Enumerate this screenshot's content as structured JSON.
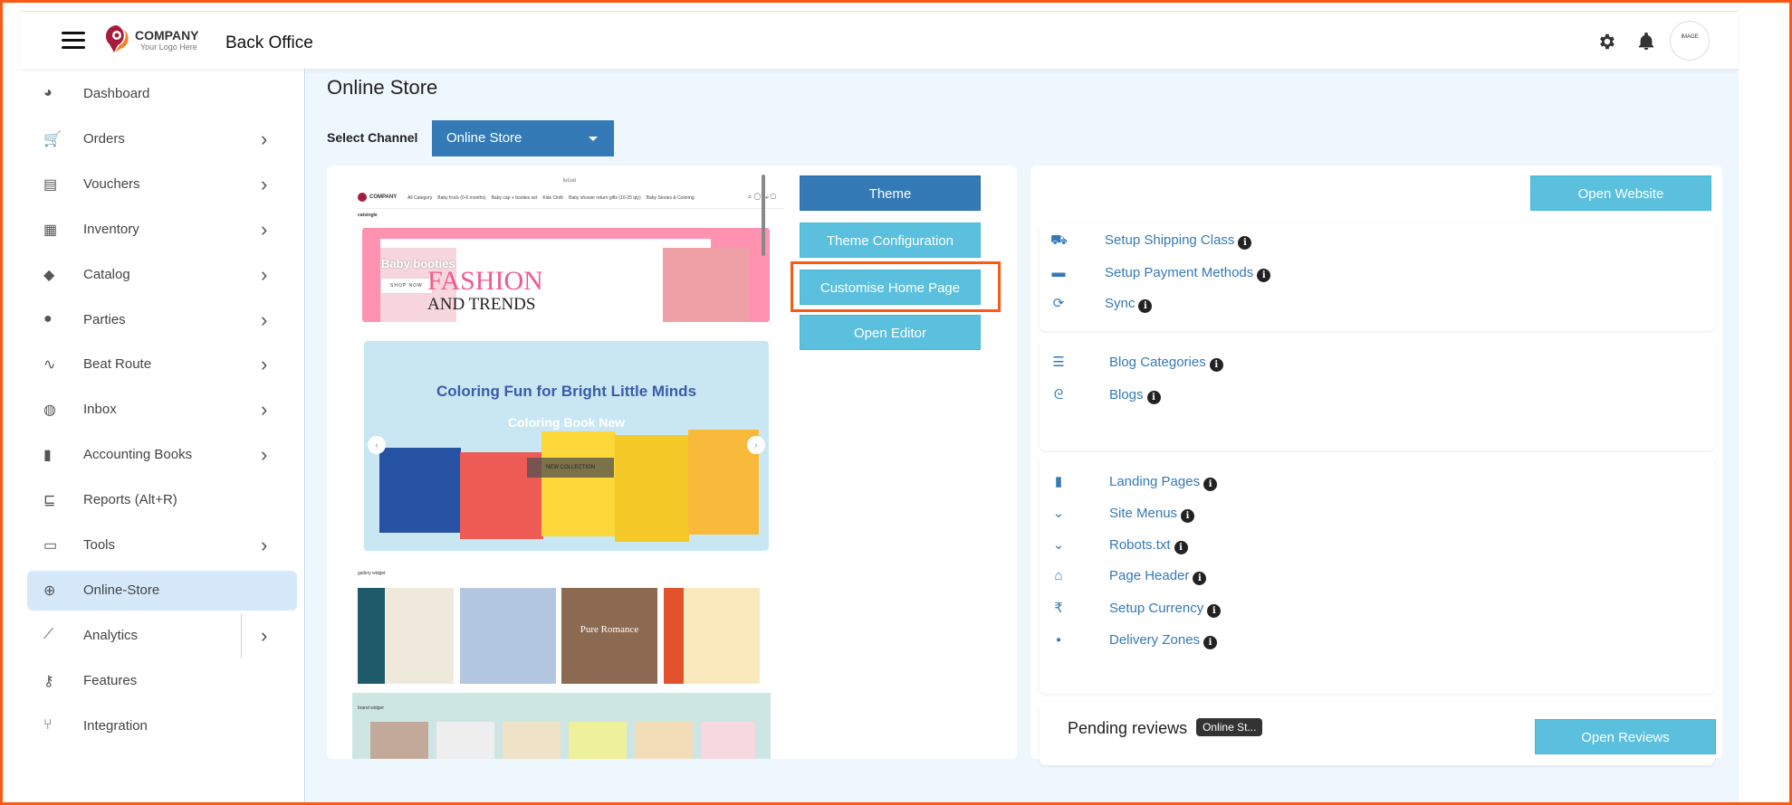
{
  "header": {
    "brand_name": "COMPANY",
    "brand_tagline": "Your Logo Here",
    "app_title": "Back Office",
    "avatar_text": "IMAGE",
    "icons": [
      "menu-icon",
      "gear-icon",
      "bell-icon"
    ]
  },
  "colors": {
    "primary": "#337ab7",
    "info": "#5bc0de",
    "highlight": "#fb5a14",
    "active_bg": "#d6e9fb"
  },
  "sidebar": {
    "items": [
      {
        "label": "Dashboard",
        "icon": "dashboard-icon",
        "chevron": false
      },
      {
        "label": "Orders",
        "icon": "cart-icon",
        "chevron": true
      },
      {
        "label": "Vouchers",
        "icon": "file-invoice-icon",
        "chevron": true
      },
      {
        "label": "Inventory",
        "icon": "boxes-icon",
        "chevron": true
      },
      {
        "label": "Catalog",
        "icon": "tags-icon",
        "chevron": true
      },
      {
        "label": "Parties",
        "icon": "user-icon",
        "chevron": true
      },
      {
        "label": "Beat Route",
        "icon": "route-icon",
        "chevron": true
      },
      {
        "label": "Inbox",
        "icon": "comments-icon",
        "chevron": true
      },
      {
        "label": "Accounting Books",
        "icon": "book-icon",
        "chevron": true
      },
      {
        "label": "Reports (Alt+R)",
        "icon": "chart-icon",
        "chevron": false
      },
      {
        "label": "Tools",
        "icon": "toolbox-icon",
        "chevron": true
      },
      {
        "label": "Online-Store",
        "icon": "globe-icon",
        "chevron": false,
        "active": true
      },
      {
        "label": "Analytics",
        "icon": "line-chart-icon",
        "chevron": true
      },
      {
        "label": "Features",
        "icon": "key-icon",
        "chevron": false
      },
      {
        "label": "Integration",
        "icon": "integration-icon",
        "chevron": false
      }
    ]
  },
  "main": {
    "title": "Online Store",
    "channel_label": "Select Channel",
    "channel_value": "Online Store",
    "preview": {
      "top_text": "lucuo",
      "brand": "COMPANY",
      "nav": [
        "All Category",
        "Baby frock (0-6 months)",
        "Baby cap + booties set",
        "Kids Cloth",
        "Baby shower return gifts (10-25 qty)",
        "Baby Stories & Coloring"
      ],
      "section1": "catsingle",
      "banner1_title": "Baby booties",
      "banner1_btn": "SHOP NOW",
      "banner1_big1": "FASHION",
      "banner1_big2": "AND TRENDS",
      "banner2_heading": "Coloring Fun for Bright Little Minds",
      "banner2_title": "Coloring Book New",
      "banner2_btn": "NEW COLLECTION",
      "section2": "gallery widget",
      "gallery_caption": "Pure Romance",
      "section3": "brand widget"
    },
    "buttons": {
      "theme": "Theme",
      "theme_config": "Theme Configuration",
      "customise": "Customise Home Page",
      "open_editor": "Open Editor",
      "open_website": "Open Website",
      "open_reviews": "Open Reviews"
    },
    "group1": [
      {
        "label": "Setup Shipping Class",
        "icon": "truck-icon"
      },
      {
        "label": "Setup Payment Methods",
        "icon": "credit-card-icon"
      },
      {
        "label": "Sync",
        "icon": "sync-icon"
      }
    ],
    "group2": [
      {
        "label": "Blog Categories",
        "icon": "list-icon"
      },
      {
        "label": "Blogs",
        "icon": "blog-icon"
      }
    ],
    "group3": [
      {
        "label": "Landing Pages",
        "icon": "file-icon"
      },
      {
        "label": "Site Menus",
        "icon": "chevron-circle-down-icon"
      },
      {
        "label": "Robots.txt",
        "icon": "chevron-circle-down-icon"
      },
      {
        "label": "Page Header",
        "icon": "home-icon"
      },
      {
        "label": "Setup Currency",
        "icon": "rupee-icon"
      },
      {
        "label": "Delivery Zones",
        "icon": "square-icon"
      }
    ],
    "pending": {
      "title": "Pending reviews",
      "badge": "Online St..."
    }
  }
}
